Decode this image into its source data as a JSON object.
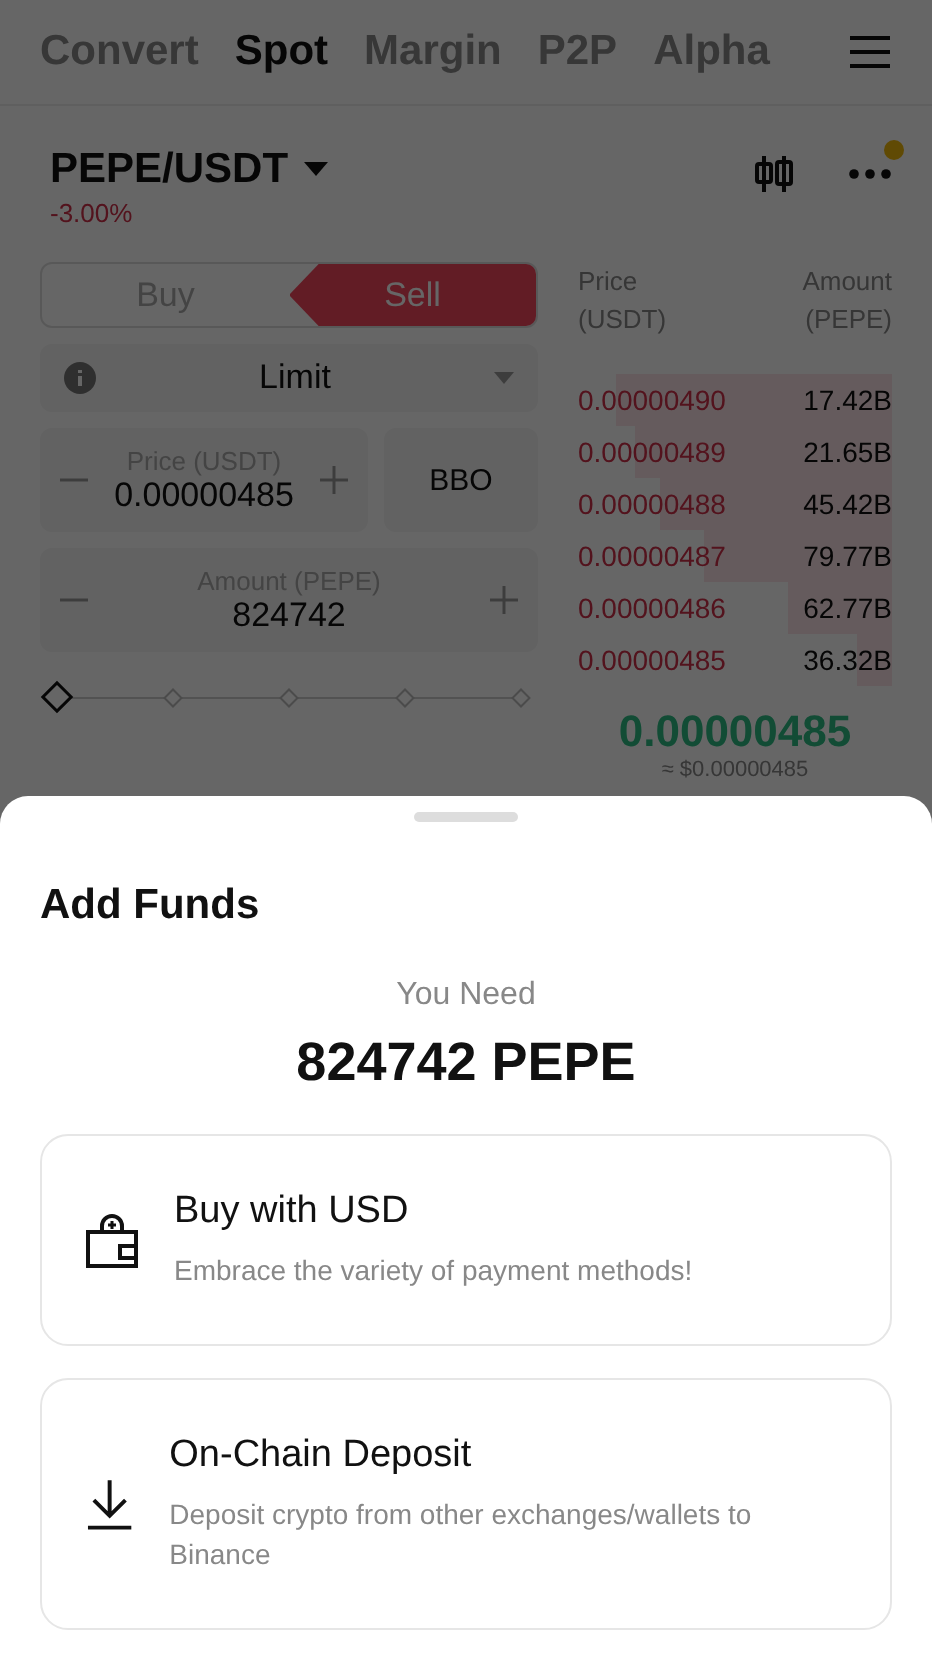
{
  "nav_tabs": [
    {
      "label": "Convert",
      "selected": false
    },
    {
      "label": "Spot",
      "selected": true
    },
    {
      "label": "Margin",
      "selected": false
    },
    {
      "label": "P2P",
      "selected": false
    },
    {
      "label": "Alpha",
      "selected": false
    }
  ],
  "pair": {
    "symbol": "PEPE/USDT",
    "change": "-3.00%",
    "notification": true
  },
  "side_toggle": [
    {
      "label": "Buy",
      "selected": false
    },
    {
      "label": "Sell",
      "selected": true
    }
  ],
  "order_type": "Limit",
  "price_field": {
    "label": "Price (USDT)",
    "value": "0.00000485"
  },
  "bbo_button": "BBO",
  "amount_field": {
    "label": "Amount (PEPE)",
    "value": "824742"
  },
  "order_book": {
    "price_header": "Price (USDT)",
    "amount_header": "Amount (PEPE)",
    "asks": [
      {
        "price": "0.00000490",
        "amount": "17.42B"
      },
      {
        "price": "0.00000489",
        "amount": "21.65B"
      },
      {
        "price": "0.00000488",
        "amount": "45.42B"
      },
      {
        "price": "0.00000487",
        "amount": "79.77B"
      },
      {
        "price": "0.00000486",
        "amount": "62.77B"
      },
      {
        "price": "0.00000485",
        "amount": "36.32B"
      }
    ],
    "last_price": "0.00000485",
    "last_price_fiat": "≈ $0.00000485"
  },
  "sheet": {
    "title": "Add Funds",
    "need_label": "You Need",
    "need_amount": "824742 PEPE",
    "options": [
      {
        "kind": "buy",
        "title": "Buy with USD",
        "description": "Embrace the variety of payment methods!"
      },
      {
        "kind": "deposit",
        "title": "On-Chain Deposit",
        "description": "Deposit crypto from other exchanges/wallets to Binance"
      }
    ]
  }
}
